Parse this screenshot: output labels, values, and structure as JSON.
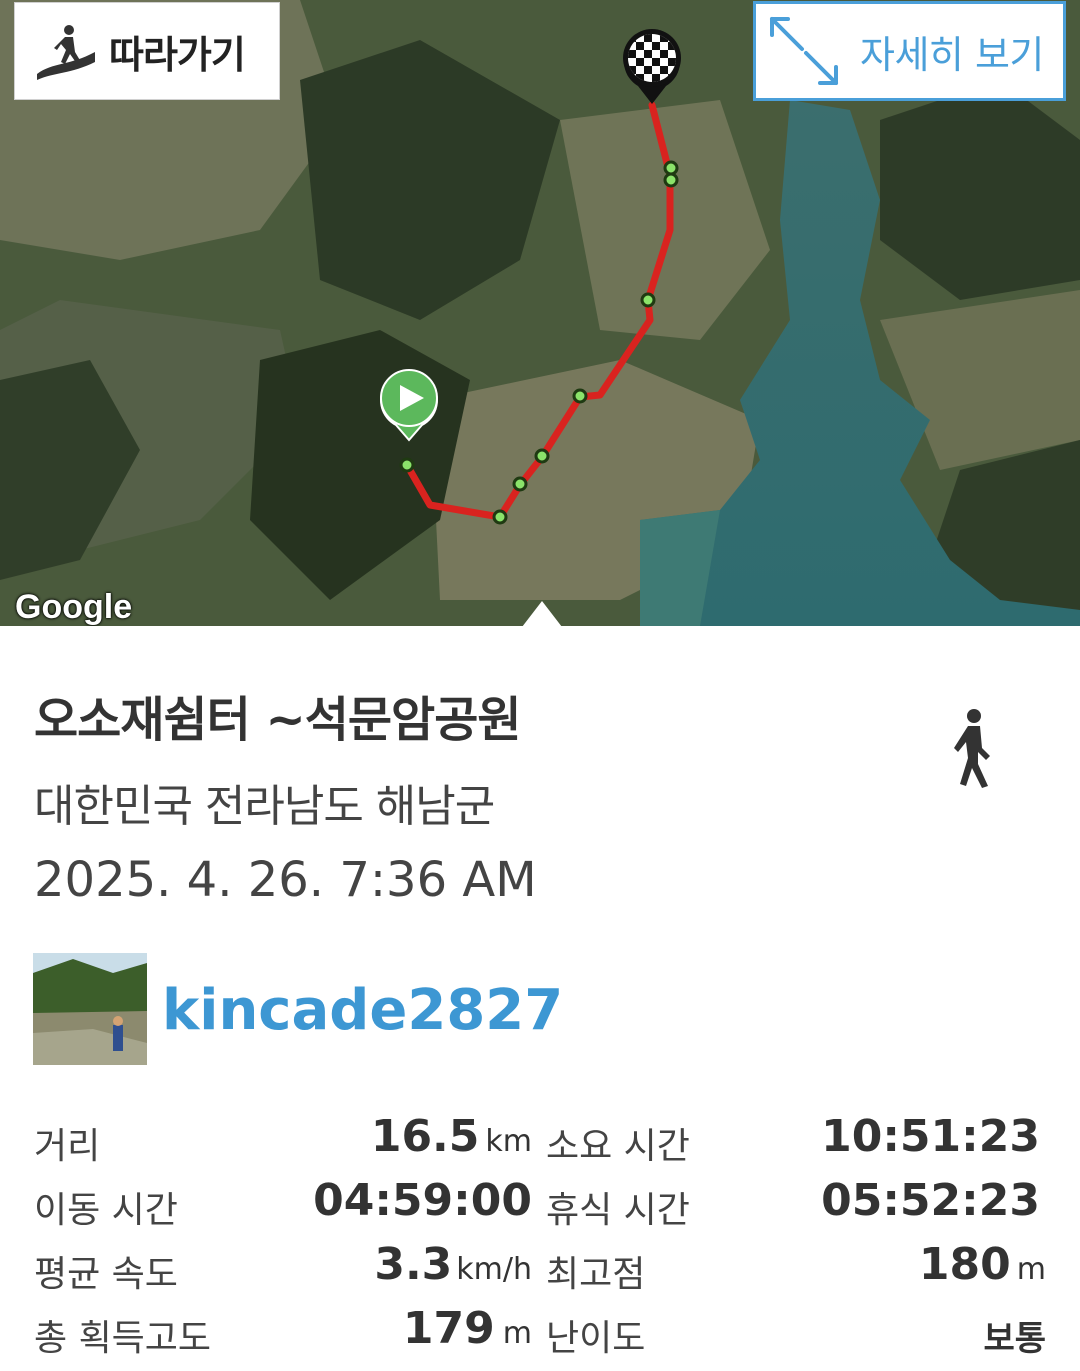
{
  "map": {
    "follow_label": "따라가기",
    "detail_label": "자세히 보기",
    "google_label": "Google",
    "route_color": "#d9231f",
    "start_marker_color": "#5cb85c"
  },
  "trip": {
    "title": "오소재쉼터 ~석문암공원",
    "region": "대한민국 전라남도 해남군",
    "datetime": "2025. 4. 26. 7:36 AM",
    "activity_icon": "walking-person-icon"
  },
  "user": {
    "username": "kincade2827"
  },
  "stats": {
    "distance_label": "거리",
    "distance_value": "16.5",
    "distance_unit": "km",
    "total_time_label": "소요 시간",
    "total_time_value": "10:51:23",
    "moving_time_label": "이동 시간",
    "moving_time_value": "04:59:00",
    "rest_time_label": "휴식 시간",
    "rest_time_value": "05:52:23",
    "avg_speed_label": "평균 속도",
    "avg_speed_value": "3.3",
    "avg_speed_unit": "km/h",
    "max_alt_label": "최고점",
    "max_alt_value": "180",
    "max_alt_unit": "m",
    "gain_label": "총 획득고도",
    "gain_value": "179",
    "gain_unit": "m",
    "difficulty_label": "난이도",
    "difficulty_value": "보통"
  }
}
